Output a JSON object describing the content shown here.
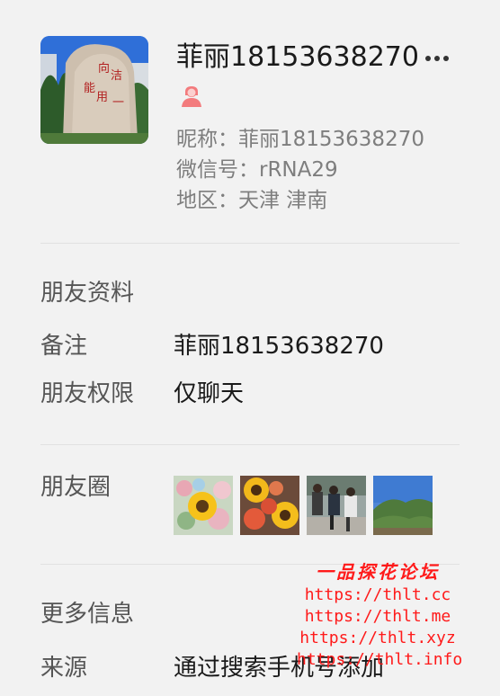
{
  "profile": {
    "display_name": "菲丽18153638270",
    "nickname_line": "昵称：菲丽18153638270",
    "wechat_id_line": "微信号：rRNA29",
    "region_line": "地区：天津 津南",
    "more_label": "···"
  },
  "friend_info": {
    "section_title": "朋友资料",
    "remark_label": "备注",
    "remark_value": "菲丽18153638270",
    "permission_label": "朋友权限",
    "permission_value": "仅聊天"
  },
  "moments": {
    "label": "朋友圈"
  },
  "more_info": {
    "section_title": "更多信息",
    "source_label": "来源",
    "source_value": "通过搜索手机号添加"
  },
  "watermark": {
    "title": "一品探花论坛",
    "urls": [
      "https://thlt.cc",
      "https://thlt.me",
      "https://thlt.xyz",
      "https://thlt.info"
    ]
  },
  "colors": {
    "background": "#f2f2f2",
    "gender_icon": "#f37b7d",
    "watermark": "#ff1a1a"
  }
}
